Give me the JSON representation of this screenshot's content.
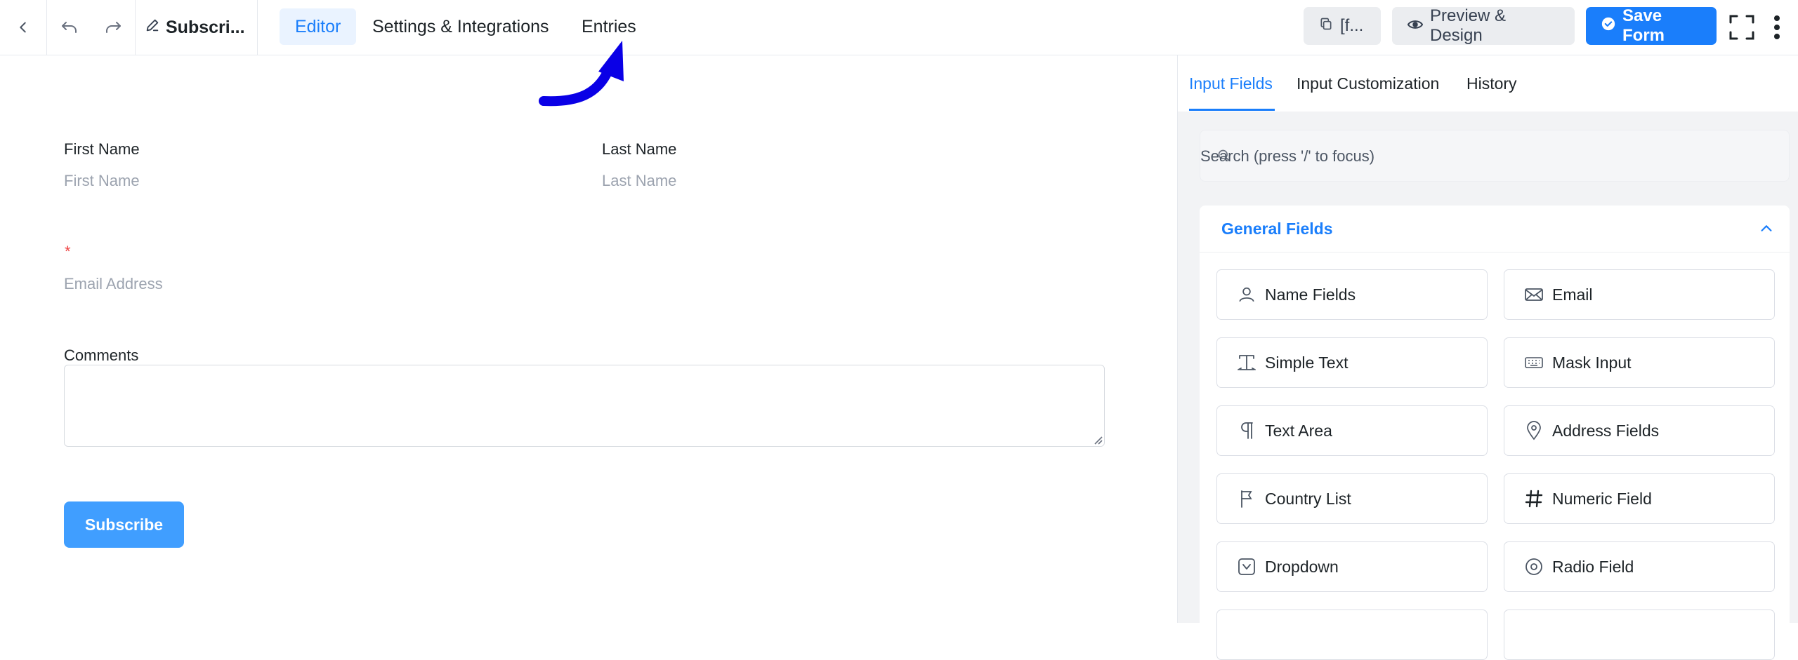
{
  "header": {
    "form_title": "Subscri...",
    "tabs": [
      {
        "label": "Editor",
        "active": true
      },
      {
        "label": "Settings & Integrations",
        "active": false
      },
      {
        "label": "Entries",
        "active": false
      }
    ],
    "shortcode_label": "[f...",
    "preview_label": "Preview & Design",
    "save_label": "Save Form"
  },
  "form": {
    "first_name_label": "First Name",
    "first_name_placeholder": "First Name",
    "last_name_label": "Last Name",
    "last_name_placeholder": "Last Name",
    "email_required_mark": "*",
    "email_placeholder": "Email Address",
    "comments_label": "Comments",
    "submit_label": "Subscribe"
  },
  "panel": {
    "tabs": [
      {
        "label": "Input Fields",
        "active": true
      },
      {
        "label": "Input Customization",
        "active": false
      },
      {
        "label": "History",
        "active": false
      }
    ],
    "search_placeholder": "Search (press '/' to focus)",
    "section_title": "General Fields",
    "fields": [
      {
        "label": "Name Fields",
        "icon": "user-icon"
      },
      {
        "label": "Email",
        "icon": "envelope-icon"
      },
      {
        "label": "Simple Text",
        "icon": "text-cursor-icon"
      },
      {
        "label": "Mask Input",
        "icon": "keyboard-icon"
      },
      {
        "label": "Text Area",
        "icon": "paragraph-icon"
      },
      {
        "label": "Address Fields",
        "icon": "map-pin-icon"
      },
      {
        "label": "Country List",
        "icon": "flag-icon"
      },
      {
        "label": "Numeric Field",
        "icon": "hash-icon"
      },
      {
        "label": "Dropdown",
        "icon": "dropdown-icon"
      },
      {
        "label": "Radio Field",
        "icon": "radio-icon"
      }
    ]
  },
  "colors": {
    "accent": "#1a7efb",
    "submit_button": "#409eff",
    "annotation_arrow": "#0a00e6",
    "required": "#ef4444"
  }
}
